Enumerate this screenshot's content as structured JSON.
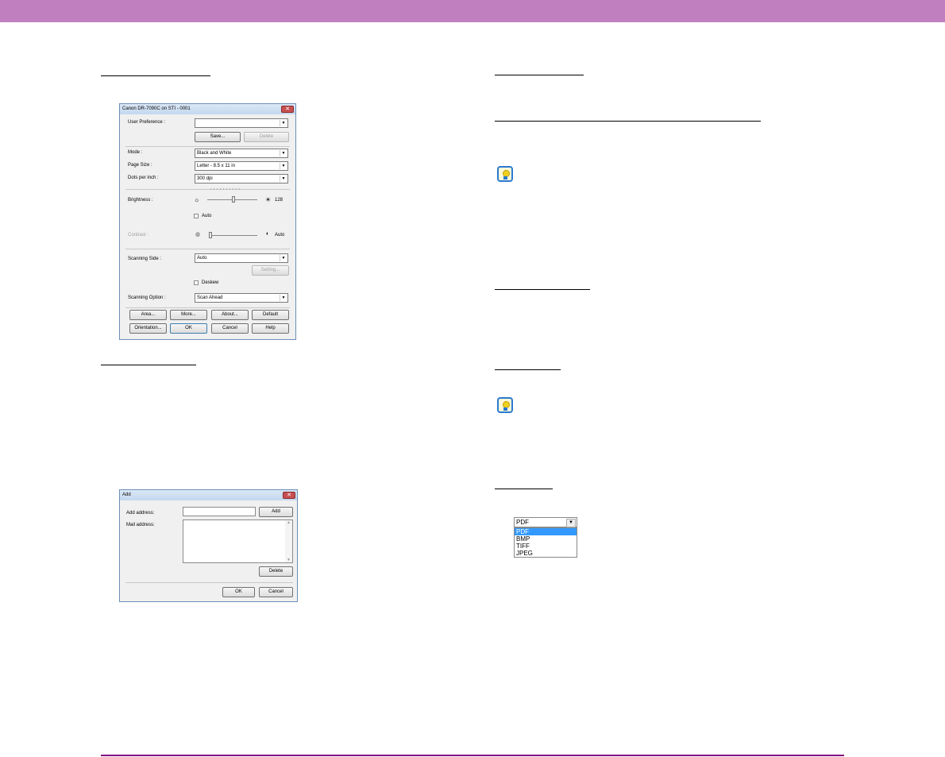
{
  "dialog_scanner": {
    "title": "Canon DR-7090C on STI - 0001",
    "close": "✕",
    "user_preference_label": "User Preference :",
    "user_preference_value": "",
    "save_button": "Save...",
    "delete_button": "Delete",
    "mode_label": "Mode :",
    "mode_value": "Black and White",
    "page_size_label": "Page Size :",
    "page_size_value": "Letter - 8.5 x 11 in",
    "dpi_label": "Dots per inch :",
    "dpi_value": "300 dpi",
    "brightness_label": "Brightness :",
    "brightness_value": "128",
    "brightness_auto_label": "Auto",
    "contrast_label": "Contrast :",
    "contrast_value": "Auto",
    "scanning_side_label": "Scanning Side :",
    "scanning_side_value": "Auto",
    "setting_button": "Setting...",
    "deskew_label": "Deskew",
    "scanning_option_label": "Scanning Option :",
    "scanning_option_value": "Scan Ahead",
    "buttons": [
      "Area...",
      "More...",
      "About...",
      "Default",
      "Orientation...",
      "OK",
      "Cancel",
      "Help"
    ]
  },
  "dialog_add": {
    "title": "Add",
    "close": "✕",
    "add_address_label": "Add address:",
    "add_address_value": "",
    "add_button": "Add",
    "mail_address_label": "Mail address:",
    "delete_button": "Delete",
    "ok_button": "OK",
    "cancel_button": "Cancel"
  },
  "file_type_dropdown": {
    "selected": "PDF",
    "options": [
      "PDF",
      "BMP",
      "TIFF",
      "JPEG"
    ]
  },
  "colors": {
    "header": "#c080c0",
    "footer_line": "#800080"
  }
}
